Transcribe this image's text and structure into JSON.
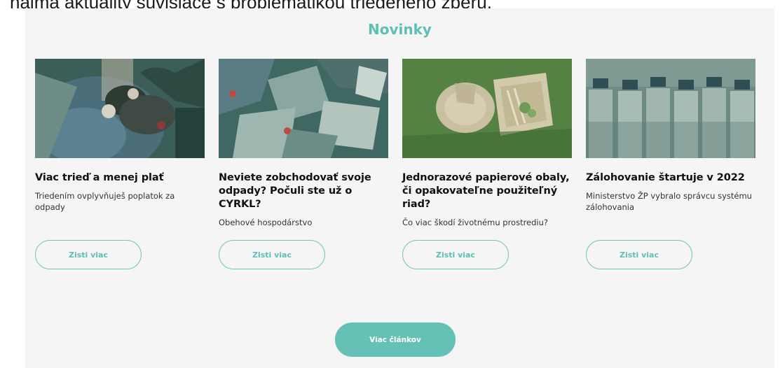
{
  "header_partial": "najmä aktuality súvisiace s problematikou triedeného zberu.",
  "section": {
    "title": "Novinky",
    "more_button": "Viac článkov"
  },
  "cards": [
    {
      "title": "Viac trieď a menej plať",
      "subtitle": "Triedením ovplyvňuješ poplatok za odpady",
      "button": "Zisti viac"
    },
    {
      "title": "Neviete zobchodovať svoje odpady? Počuli ste už o CYRKL?",
      "subtitle": "Obehové hospodárstvo",
      "button": "Zisti viac"
    },
    {
      "title": "Jednorazové papierové obaly, či opakovateľne použiteľný riad?",
      "subtitle": "Čo viac škodí životnému prostrediu?",
      "button": "Zisti viac"
    },
    {
      "title": "Zálohovanie štartuje v 2022",
      "subtitle": "Ministerstvo ŽP vybralo správcu systému zálohovania",
      "button": "Zisti viac"
    }
  ],
  "colors": {
    "accent": "#5dbfb3",
    "button_fill": "#65c0b6",
    "section_bg": "#f5f5f5"
  }
}
